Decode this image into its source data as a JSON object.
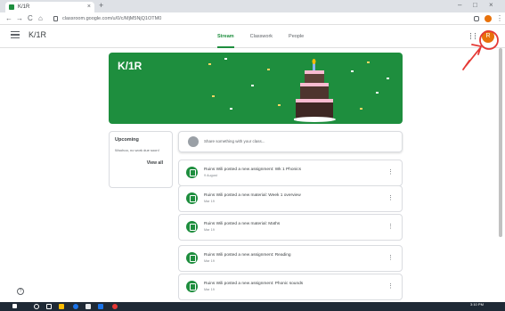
{
  "browser": {
    "tab_title": "K/1R",
    "tab_close": "×",
    "new_tab": "+",
    "window_controls": [
      "–",
      "□",
      "×"
    ],
    "nav": [
      "←",
      "→",
      "C",
      "⌂"
    ],
    "url": "classroom.google.com/u/0/c/MjM5NjQ1OTM0"
  },
  "app": {
    "class_name": "K/1R",
    "tabs": [
      "Stream",
      "Classwork",
      "People"
    ],
    "active_tab": "Stream",
    "avatar_letter": "R"
  },
  "banner": {
    "title": "K/1R",
    "color": "#1e8e3e"
  },
  "upcoming": {
    "title": "Upcoming",
    "text": "Woohoo, no work due soon!",
    "link": "View all"
  },
  "share": {
    "placeholder": "Share something with your class..."
  },
  "posts": [
    {
      "title": "Ruins Wili posted a new assignment: Wk 1 Phonics",
      "date": "9 August"
    },
    {
      "title": "Ruins Wili posted a new material: Week 1 overview",
      "date": "Mar 19"
    },
    {
      "title": "Ruins Wili posted a new material: Maths",
      "date": "Mar 19"
    },
    {
      "title": "Ruins Wili posted a new assignment: Reading",
      "date": "Mar 19"
    },
    {
      "title": "Ruins Wili posted a new assignment: Phonic sounds",
      "date": "Mar 19"
    }
  ],
  "post_menu": "⋮",
  "taskbar": {
    "time": "3:10 PM"
  },
  "help_icon": "?"
}
